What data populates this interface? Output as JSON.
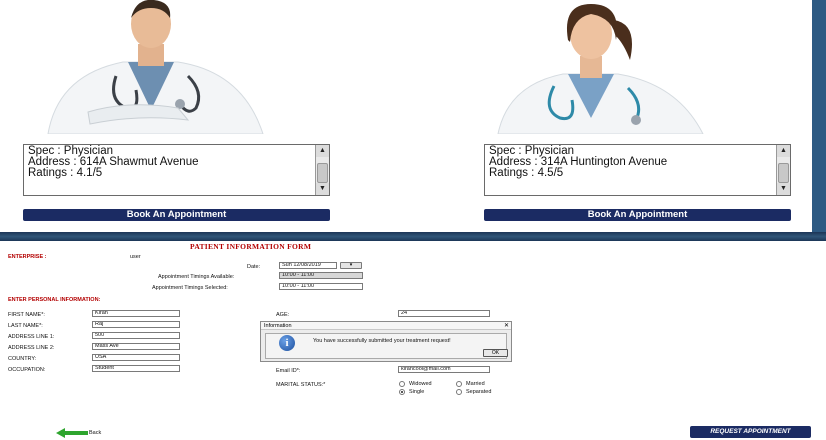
{
  "doctors": [
    {
      "info_lines": [
        "Spec : Physician",
        "Address : 614A Shawmut Avenue",
        "Ratings : 4.1/5"
      ],
      "book_label": "Book An Appointment"
    },
    {
      "info_lines": [
        "Spec : Physician",
        "Address : 314A Huntington Avenue",
        "Ratings : 4.5/5"
      ],
      "book_label": "Book An Appointment"
    }
  ],
  "form": {
    "title": "PATIENT INFORMATION FORM",
    "enterprise_label": "ENTERPRISE :",
    "enterprise_value": "user",
    "date_label": "Date:",
    "date_value": "Sun 12/08/2019",
    "date_button": "▾",
    "timings_available_label": "Appointment Timings Available:",
    "timings_available_value": "10:00 - 11:00",
    "timings_selected_label": "Appointment Timings Selected:",
    "timings_selected_value": "10:00 - 11:00",
    "personal_header": "ENTER PERSONAL INFORMATION:",
    "first_name_label": "FIRST NAME*:",
    "first_name_value": "Kiran",
    "last_name_label": "LAST NAME*:",
    "last_name_value": "Raj",
    "address1_label": "ADDRESS LINE 1:",
    "address1_value": "500",
    "address2_label": "ADDRESS LINE 2:",
    "address2_value": "Mass Ave",
    "country_label": "COUNTRY:",
    "country_value": "USA",
    "occupation_label": "OCCUPATION:",
    "occupation_value": "Student",
    "age_label": "AGE:",
    "age_value": "24",
    "email_label": "Email ID*:",
    "email_value": "kirancool@mail.com",
    "marital_label": "MARITAL STATUS:*",
    "marital_options": [
      "Widowed",
      "Married",
      "Single",
      "Separated"
    ],
    "marital_selected": "Single"
  },
  "dialog": {
    "title": "Information",
    "close": "✕",
    "icon_letter": "i",
    "message": "You have successfully submitted your treatment request!",
    "ok_label": "OK"
  },
  "back_label": "Back",
  "request_label": "REQUEST APPOINTMENT",
  "colors": {
    "brand_navy": "#1b2b63",
    "form_red": "#b30000",
    "band_blue": "#2d5a83"
  }
}
